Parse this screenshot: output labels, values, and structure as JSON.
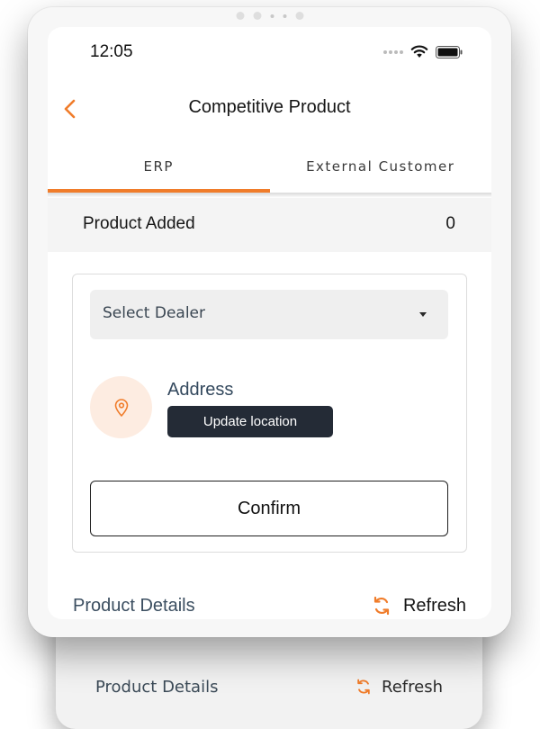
{
  "status_bar": {
    "time": "12:05"
  },
  "nav": {
    "title": "Competitive Product"
  },
  "tabs": [
    {
      "label": "ERP",
      "active": true
    },
    {
      "label": "External Customer",
      "active": false
    }
  ],
  "summary": {
    "label": "Product Added",
    "count": "0"
  },
  "card": {
    "dealer_select": {
      "value": "Select Dealer"
    },
    "address": {
      "title": "Address",
      "update_label": "Update location"
    },
    "confirm_label": "Confirm"
  },
  "details": {
    "title": "Product Details",
    "refresh_label": "Refresh"
  },
  "colors": {
    "accent": "#f07c2a",
    "dark_button": "#242b36",
    "heading_blue": "#3b4e60"
  }
}
